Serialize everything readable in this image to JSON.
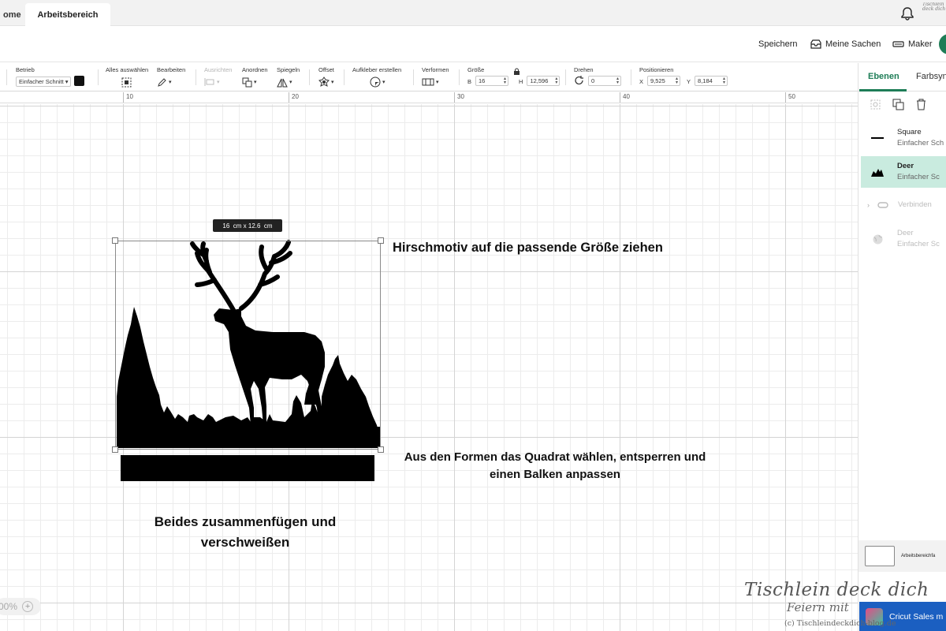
{
  "tabs": {
    "home": "ome",
    "workspace": "Arbeitsbereich"
  },
  "logo_small": "Tischlein deck dich",
  "actions": {
    "save": "Speichern",
    "my_stuff": "Meine Sachen",
    "maker": "Maker"
  },
  "toolbar": {
    "operation_label": "Betrieb",
    "operation_value": "Einfacher Schnitt",
    "select_all": "Alles auswählen",
    "edit": "Bearbeiten",
    "align": "Ausrichten",
    "arrange": "Anordnen",
    "flip": "Spiegeln",
    "offset": "Offset",
    "sticker": "Aufkleber erstellen",
    "warp": "Verformen",
    "size": "Größe",
    "w_label": "B",
    "w_value": "16",
    "h_label": "H",
    "h_value": "12,596",
    "rotate": "Drehen",
    "rotate_value": "0",
    "position": "Positionieren",
    "x_label": "X",
    "x_value": "9,525",
    "y_label": "Y",
    "y_value": "8,184"
  },
  "ruler": {
    "labels": [
      "10",
      "20",
      "30",
      "40",
      "50"
    ]
  },
  "canvas": {
    "size_tooltip": "16  cm x 12.6  cm",
    "note1": "Hirschmotiv auf die passende Größe ziehen",
    "note2": "Aus den Formen das Quadrat wählen, entsperren und einen Balken anpassen",
    "note3": "Beides zusammenfügen und verschweißen",
    "zoom": "00%"
  },
  "panel": {
    "tab_layers": "Ebenen",
    "tab_color": "Farbsyn",
    "layers": [
      {
        "name": "Square",
        "sub": "Einfacher Sch"
      },
      {
        "name": "Deer",
        "sub": "Einfacher Sc"
      },
      {
        "name": "Verbinden",
        "sub": ""
      },
      {
        "name": "Deer",
        "sub": "Einfacher Sc"
      }
    ],
    "canvas_label": "Arbeitsbereichfa",
    "sales": "Cricut Sales m"
  },
  "watermark": {
    "line1": "Tischlein deck dich",
    "line2": "Feiern mit",
    "line3": "(c) Tischleindeckdich-blog.de"
  },
  "colors": {
    "accent": "#1e7d57",
    "selected_layer": "#c9ebdf",
    "sales_bg": "#1b5fc1"
  }
}
